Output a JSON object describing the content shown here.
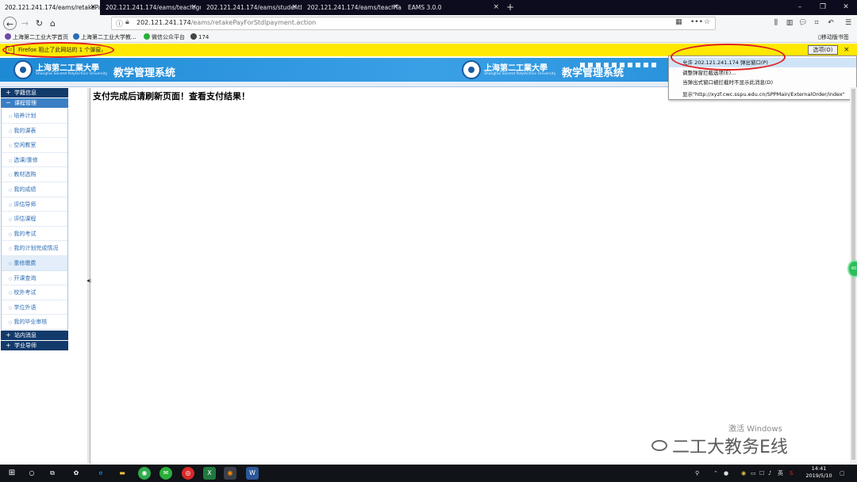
{
  "browser": {
    "tabs": [
      {
        "label": "202.121.241.174/eams/retakePa"
      },
      {
        "label": "202.121.241.174/eams/teach/gr"
      },
      {
        "label": "202.121.241.174/eams/studentIc"
      },
      {
        "label": "202.121.241.174/eams/teachTa"
      },
      {
        "label": "EAMS 3.0.0"
      }
    ],
    "tab_close": "×",
    "new_tab": "+",
    "url_host": "202.121.241.174",
    "url_path": "/eams/retakePayForStdlpayment.action",
    "url_more": "•••",
    "bookmarks": [
      {
        "label": "上海第二工业大学首页",
        "color": "#6b4aa8"
      },
      {
        "label": "上海第二工业大学教...",
        "color": "#2c6db3"
      },
      {
        "label": "微信公众平台",
        "color": "#2aae3a"
      },
      {
        "label": "174",
        "color": "#444444"
      }
    ],
    "mobile_bookmarks": "移动版书签"
  },
  "notification": {
    "text": "Firefox 阻止了此网站的 1 个弹窗。",
    "options_button": "选项(O)",
    "close": "×"
  },
  "popup_menu": {
    "items": [
      {
        "label": "允许 202.121.241.174 弹出窗口(P)"
      },
      {
        "label": "调整弹窗拦截选项(E)..."
      },
      {
        "label": "当弹出式窗口被拦截时不显示此消息(D)"
      },
      {
        "label": "显示\"http://xyzf.cwc.sspu.edu.cn/SPPMain/ExternalOrder/index\""
      }
    ]
  },
  "banner": {
    "school_name": "上海第二工業大學",
    "school_name_en": "Shanghai Second Polytechnic University",
    "system_name": "教学管理系统"
  },
  "sidemenu": {
    "sections": [
      {
        "label": "学籍信息",
        "symbol": "+"
      },
      {
        "label": "课程管理",
        "symbol": "−"
      },
      {
        "label": "站内消息",
        "symbol": "+"
      },
      {
        "label": "学业导师",
        "symbol": "+"
      }
    ],
    "course_items": [
      {
        "label": "培养计划"
      },
      {
        "label": "我的课表"
      },
      {
        "label": "空闲教室"
      },
      {
        "label": "选课/重修"
      },
      {
        "label": "教材选购"
      },
      {
        "label": "我的成绩"
      },
      {
        "label": "评估导师"
      },
      {
        "label": "评估课程"
      },
      {
        "label": "我的考试"
      },
      {
        "label": "我的计划完成情况"
      },
      {
        "label": "重修缴费"
      },
      {
        "label": "开课查询"
      },
      {
        "label": "校外考试"
      },
      {
        "label": "学位外语"
      },
      {
        "label": "我的毕业审核"
      }
    ],
    "selected": "重修缴费"
  },
  "content": {
    "message": "支付完成后请刷新页面！查看支付结果！"
  },
  "watermark": {
    "activate": "激活 Windows",
    "account": "二工大教务E线"
  },
  "taskbar": {
    "time": "14:41",
    "date": "2019/5/10",
    "ime": "英"
  }
}
